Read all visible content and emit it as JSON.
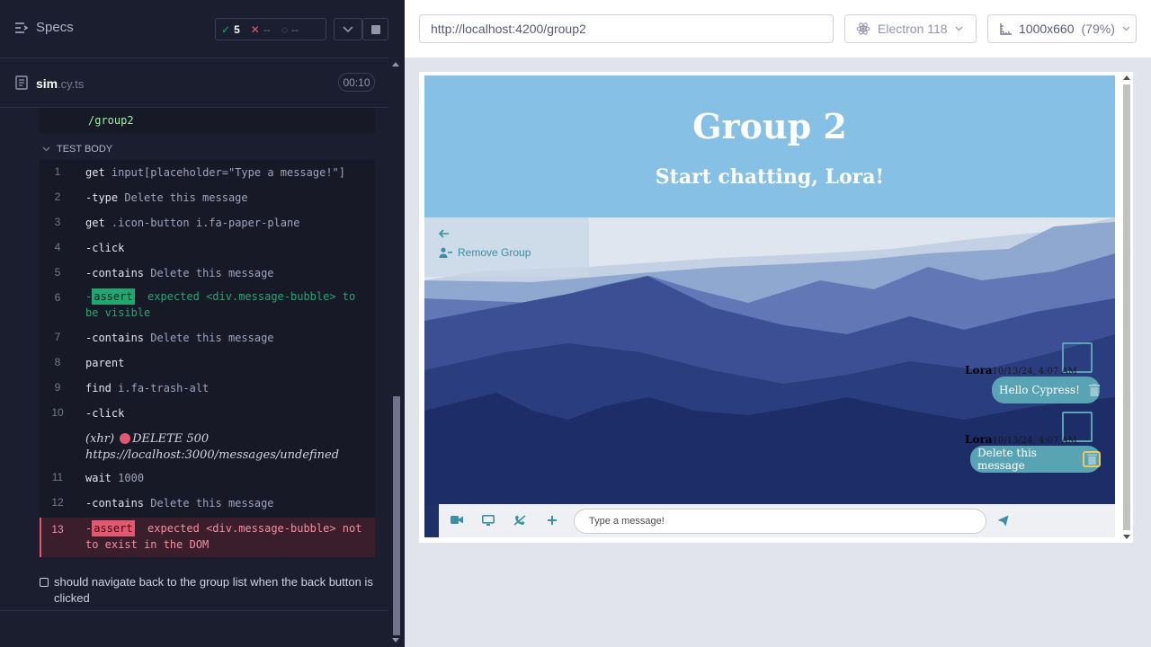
{
  "reporter": {
    "specs_label": "Specs",
    "stats": {
      "passed": "5",
      "failed": "--",
      "pending": "--"
    },
    "file": {
      "name": "sim",
      "ext": ".cy.ts",
      "duration": "00:10"
    },
    "prev_fragment": "/group2",
    "section_label": "TEST BODY",
    "commands": [
      {
        "num": "1",
        "name": "get",
        "arg": "input[placeholder=\"Type a message!\"]"
      },
      {
        "num": "2",
        "name": "-type",
        "arg": "Delete this message"
      },
      {
        "num": "3",
        "name": "get",
        "arg": ".icon-button i.fa-paper-plane"
      },
      {
        "num": "4",
        "name": "-click",
        "arg": ""
      },
      {
        "num": "5",
        "name": "-contains",
        "arg": "Delete this message"
      },
      {
        "num": "6",
        "prefix": "-",
        "badge": "assert",
        "text": "expected <div.message-bubble> to be visible"
      },
      {
        "num": "7",
        "name": "-contains",
        "arg": "Delete this message"
      },
      {
        "num": "8",
        "name": "parent",
        "arg": ""
      },
      {
        "num": "9",
        "name": "find",
        "arg": "i.fa-trash-alt"
      },
      {
        "num": "10",
        "name": "-click",
        "arg": ""
      },
      {
        "xhr_label": "(xhr)",
        "xhr_method": "DELETE 500",
        "xhr_url": "https://localhost:3000/messages/undefined"
      },
      {
        "num": "11",
        "name": "wait",
        "arg": "1000"
      },
      {
        "num": "12",
        "name": "-contains",
        "arg": "Delete this message"
      },
      {
        "num": "13",
        "prefix": "-",
        "badge": "assert",
        "text": "expected <div.message-bubble> not to exist in the DOM"
      }
    ],
    "next_test": "should navigate back to the group list when the back button is clicked"
  },
  "toolbar": {
    "url": "http://localhost:4200/group2",
    "browser": "Electron 118",
    "viewport": "1000x660",
    "zoom": "(79%)"
  },
  "app": {
    "title": "Group 2",
    "greeting": "Start chatting, Lora!",
    "remove_group": "Remove Group",
    "messages": [
      {
        "author": "Lora",
        "time": "10/13/24, 4:07 AM",
        "text": "Hello Cypress!"
      },
      {
        "author": "Lora",
        "time": "10/13/24, 4:07 AM",
        "text": "Delete this message"
      }
    ],
    "input_placeholder": "Type a message!"
  },
  "colors": {
    "accent": "#58a4b4",
    "pass": "#1fa971",
    "fail": "#e45770",
    "header_sky": "#86c1e5"
  }
}
